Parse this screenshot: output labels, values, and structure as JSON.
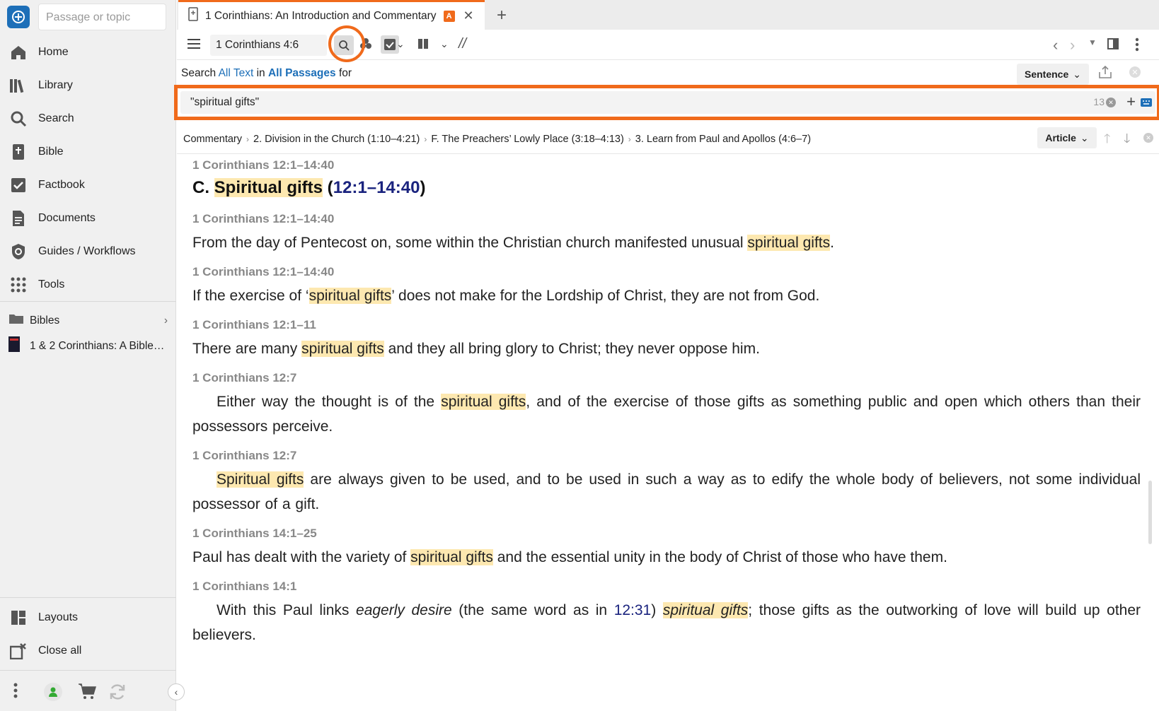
{
  "sidebar": {
    "passage_placeholder": "Passage or topic",
    "nav": [
      {
        "label": "Home",
        "icon": "home-icon"
      },
      {
        "label": "Library",
        "icon": "library-icon"
      },
      {
        "label": "Search",
        "icon": "search-icon"
      },
      {
        "label": "Bible",
        "icon": "bible-icon"
      },
      {
        "label": "Factbook",
        "icon": "factbook-icon"
      },
      {
        "label": "Documents",
        "icon": "documents-icon"
      },
      {
        "label": "Guides / Workflows",
        "icon": "guides-icon"
      },
      {
        "label": "Tools",
        "icon": "tools-icon"
      }
    ],
    "bibles_label": "Bibles",
    "resource_label": "1 & 2 Corinthians: A Bible…",
    "bottom": [
      {
        "label": "Layouts",
        "icon": "layouts-icon"
      },
      {
        "label": "Close all",
        "icon": "close-all-icon"
      }
    ]
  },
  "tab": {
    "title": "1 Corinthians: An Introduction and Commentary",
    "badge": "A"
  },
  "toolbar": {
    "reference": "1 Corinthians 4:6",
    "parallel": "//"
  },
  "search": {
    "prefix": "Search",
    "scope_text": "All Text",
    "in": "in",
    "scope_passages": "All Passages",
    "for": "for",
    "mode": "Sentence",
    "query": "\"spiritual gifts\"",
    "count": "13"
  },
  "breadcrumb": [
    "Commentary",
    "2. Division in the Church (1:10–4:21)",
    "F. The Preachers’ Lowly Place (3:18–4:13)",
    "3. Learn from Paul and Apollos (4:6–7)"
  ],
  "article_btn": "Article",
  "results": [
    {
      "ref": "1 Corinthians 12:1–14:40"
    },
    {
      "heading_prefix": "C. ",
      "heading_hl": "Spiritual gifts",
      "heading_open": " (",
      "heading_ref": "12:1–14:40",
      "heading_close": ")"
    },
    {
      "ref": "1 Corinthians 12:1–14:40",
      "pre": "From the day of Pentecost on, some within the Christian church manifested unusual ",
      "hl": "spiritual gifts",
      "post": "."
    },
    {
      "ref": "1 Corinthians 12:1–14:40",
      "pre": "If the exercise of ‘",
      "hl": "spiritual gifts",
      "post": "’ does not make for the Lordship of Christ, they are not from God."
    },
    {
      "ref": "1 Corinthians 12:1–11",
      "pre": "There are many ",
      "hl": "spiritual gifts",
      "post": " and they all bring glory to Christ; they never oppose him."
    },
    {
      "ref": "1 Corinthians 12:7",
      "pre": "Either way the thought is of the ",
      "hl": "spiritual gifts",
      "post": ", and of the exercise of those gifts as something public and open which others than their possessors perceive."
    },
    {
      "ref": "1 Corinthians 12:7",
      "pre": "",
      "hl": "Spiritual gifts",
      "post": " are always given to be used, and to be used in such a way as to edify the whole body of believers, not some individual possessor of a gift."
    },
    {
      "ref": "1 Corinthians 14:1–25",
      "pre": "Paul has dealt with the variety of ",
      "hl": "spiritual gifts",
      "post": " and the essential unity in the body of Christ of those who have them."
    },
    {
      "ref": "1 Corinthians 14:1",
      "pre": "With this Paul links ",
      "em": "eagerly desire",
      "mid": " (the same word as in ",
      "link": "12:31",
      "mid2": ") ",
      "hl": "spiritual gifts",
      "post": "; those gifts as the outworking of love will build up other believers."
    }
  ]
}
